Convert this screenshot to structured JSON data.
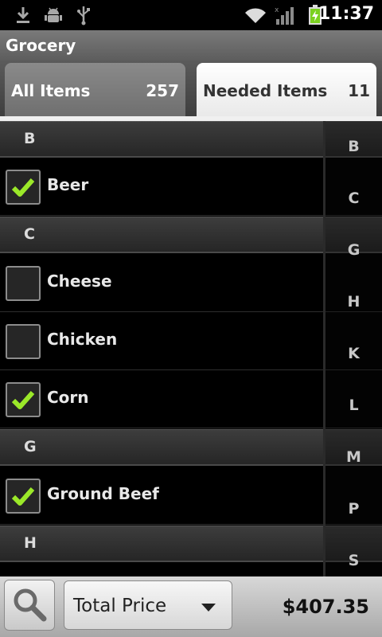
{
  "status_bar": {
    "time": "11:37"
  },
  "title": "Grocery",
  "tabs": [
    {
      "label": "All Items",
      "count": "257",
      "selected": false
    },
    {
      "label": "Needed Items",
      "count": "11",
      "selected": true
    }
  ],
  "list": {
    "sections": [
      {
        "letter": "B",
        "items": [
          {
            "name": "Beer",
            "checked": true
          }
        ]
      },
      {
        "letter": "C",
        "items": [
          {
            "name": "Cheese",
            "checked": false
          },
          {
            "name": "Chicken",
            "checked": false
          },
          {
            "name": "Corn",
            "checked": true
          }
        ]
      },
      {
        "letter": "G",
        "items": [
          {
            "name": "Ground Beef",
            "checked": true
          }
        ]
      },
      {
        "letter": "H",
        "items": []
      }
    ]
  },
  "index": [
    "B",
    "C",
    "G",
    "H",
    "K",
    "L",
    "M",
    "P",
    "S"
  ],
  "bottom_bar": {
    "spinner_label": "Total Price",
    "total": "$407.35"
  },
  "colors": {
    "check": "#9be829",
    "selected_tab": "#ffffff"
  }
}
